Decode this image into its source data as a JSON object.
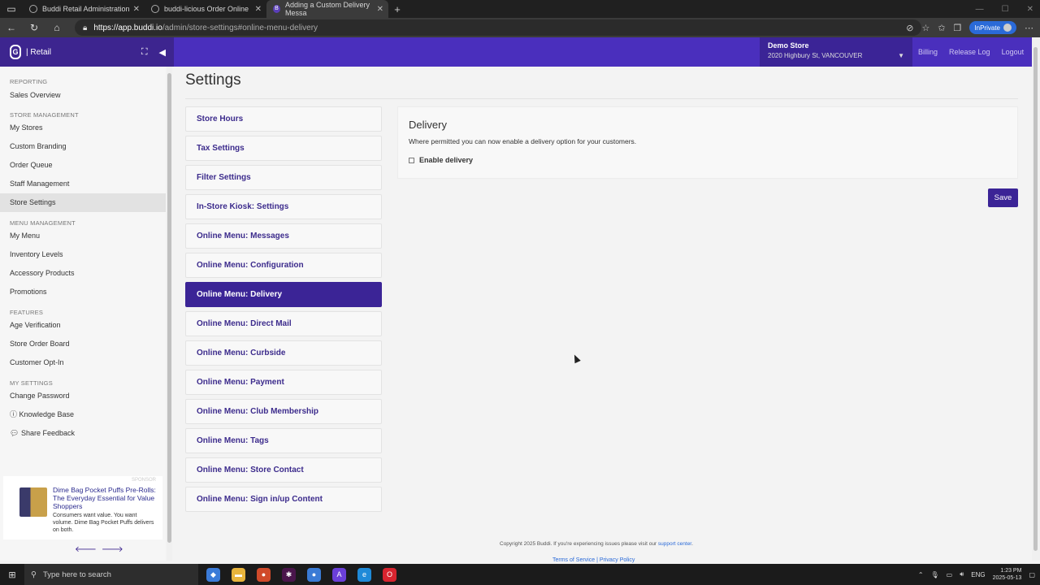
{
  "browser": {
    "tabs": [
      {
        "label": "Buddi Retail Administration",
        "icon": "globe-icon"
      },
      {
        "label": "buddi-licious Order Online",
        "icon": "globe-icon"
      },
      {
        "label": "Adding a Custom Delivery Messa",
        "icon": "b-icon",
        "active": true
      }
    ],
    "url_host": "https://app.buddi.io",
    "url_path": "/admin/store-settings#online-menu-delivery",
    "inprivate_label": "InPrivate"
  },
  "header": {
    "brand": "| Retail",
    "brand_logo": "G",
    "store_name": "Demo Store",
    "store_address": "2020 Highbury St, VANCOUVER",
    "links": [
      "Billing",
      "Release Log",
      "Logout"
    ]
  },
  "sidebar": {
    "sections": [
      {
        "title": "REPORTING",
        "items": [
          "Sales Overview"
        ]
      },
      {
        "title": "STORE MANAGEMENT",
        "items": [
          "My Stores",
          "Custom Branding",
          "Order Queue",
          "Staff Management",
          "Store Settings"
        ]
      },
      {
        "title": "MENU MANAGEMENT",
        "items": [
          "My Menu",
          "Inventory Levels",
          "Accessory Products",
          "Promotions"
        ]
      },
      {
        "title": "FEATURES",
        "items": [
          "Age Verification",
          "Store Order Board",
          "Customer Opt-In"
        ]
      },
      {
        "title": "MY SETTINGS",
        "items": [
          "Change Password",
          "Knowledge Base",
          "Share Feedback"
        ]
      }
    ],
    "active_item": "Store Settings",
    "sponsor": {
      "tag": "SPONSOR",
      "title": "Dime Bag Pocket Puffs Pre-Rolls: The Everyday Essential for Value Shoppers",
      "body": "Consumers want value. You want volume. Dime Bag Pocket Puffs delivers on both."
    }
  },
  "main": {
    "title": "Settings",
    "menu": [
      "Store Hours",
      "Tax Settings",
      "Filter Settings",
      "In-Store Kiosk: Settings",
      "Online Menu: Messages",
      "Online Menu: Configuration",
      "Online Menu: Delivery",
      "Online Menu: Direct Mail",
      "Online Menu: Curbside",
      "Online Menu: Payment",
      "Online Menu: Club Membership",
      "Online Menu: Tags",
      "Online Menu: Store Contact",
      "Online Menu: Sign in/up Content"
    ],
    "active_menu": "Online Menu: Delivery",
    "panel": {
      "title": "Delivery",
      "description": "Where permitted you can now enable a delivery option for your customers.",
      "checkbox_label": "Enable delivery"
    },
    "save_label": "Save",
    "footer_copy": "Copyright 2025 Buddi. If you're experiencing issues please visit our",
    "footer_link": "support center",
    "footer_links": "Terms of Service | Privacy Policy"
  },
  "taskbar": {
    "search_placeholder": "Type here to search",
    "lang": "ENG",
    "time": "1:23 PM",
    "date": "2025-05-13"
  },
  "colors": {
    "brand_purple": "#4a2fbd",
    "active_purple": "#3b2496",
    "link_blue": "#2a6ad8"
  }
}
